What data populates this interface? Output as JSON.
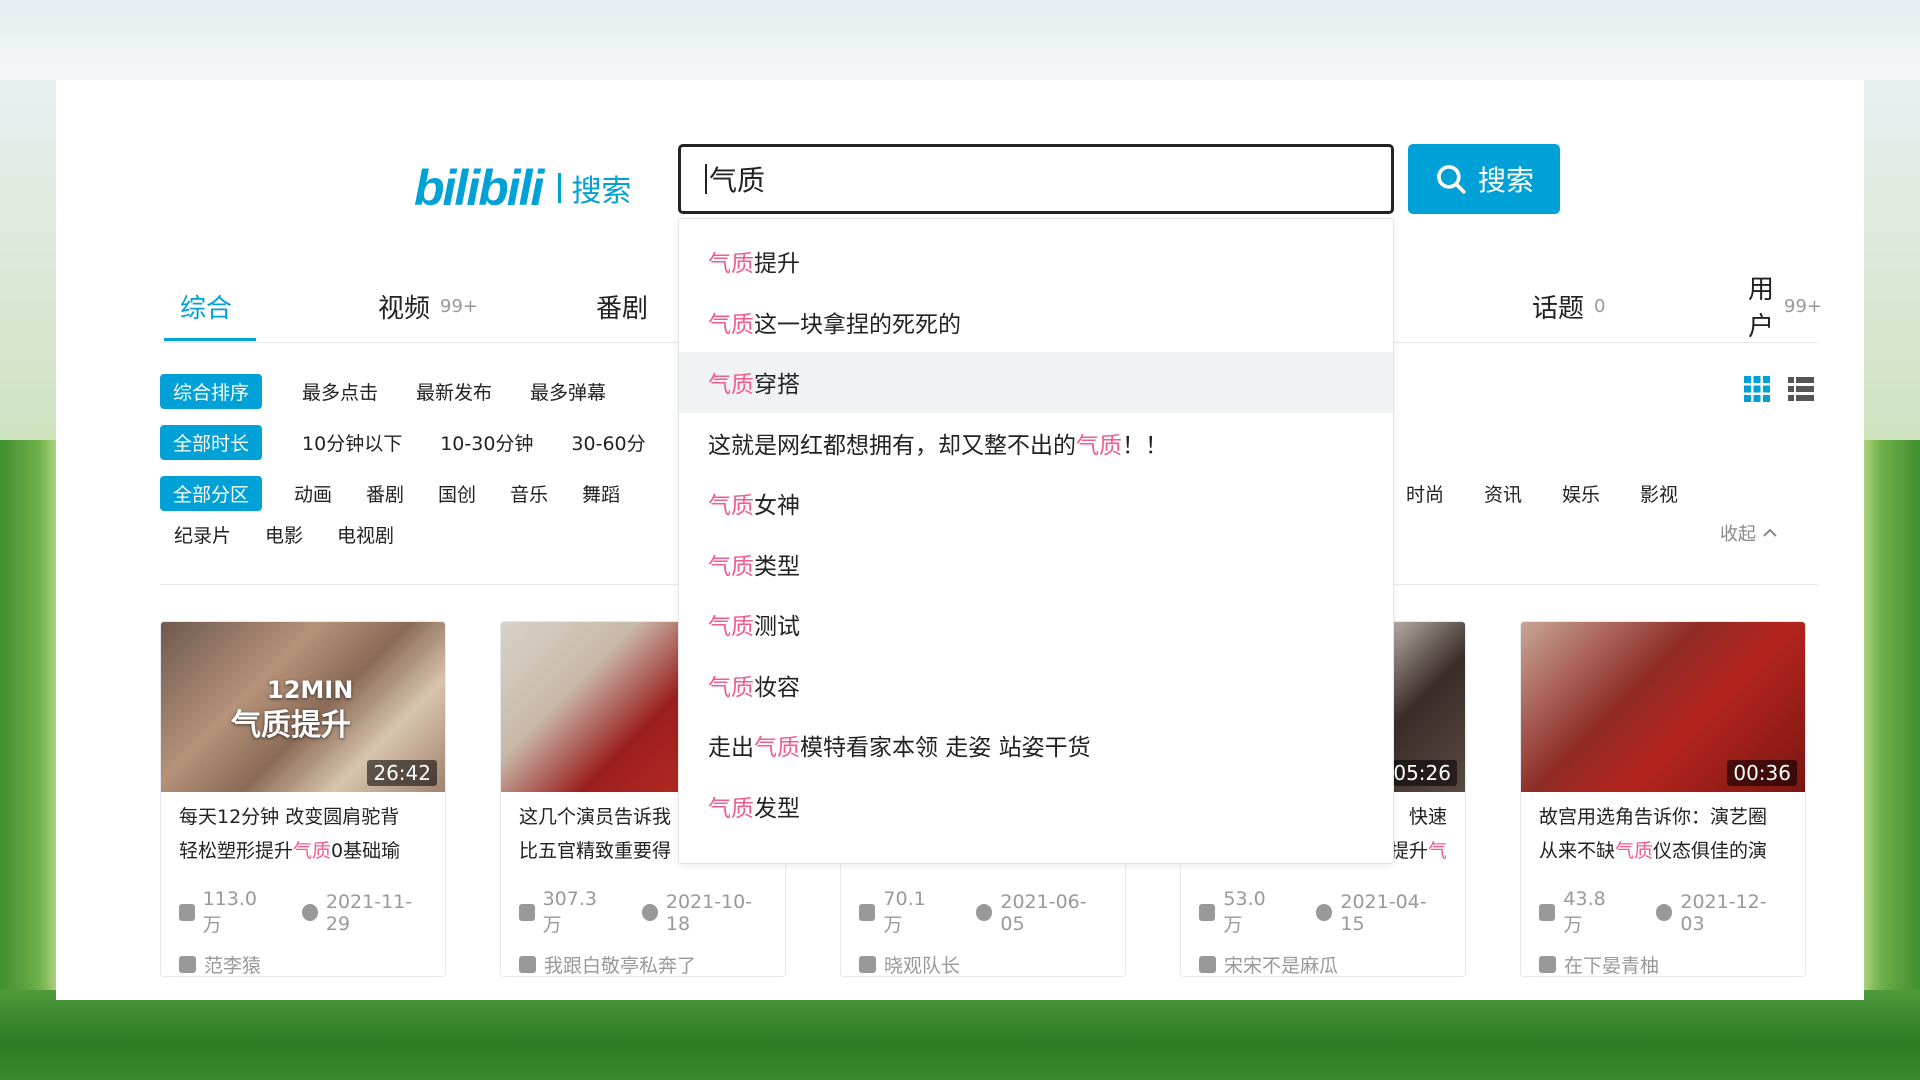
{
  "header": {
    "logo_text": "bilibili",
    "logo_sub": "搜索",
    "search_value": "气质",
    "search_button": "搜索"
  },
  "tabs": [
    {
      "label": "综合",
      "count": ""
    },
    {
      "label": "视频",
      "count": "99+"
    },
    {
      "label": "番剧",
      "count": ""
    },
    {
      "label": "话题",
      "count": "0"
    },
    {
      "label": "用户",
      "count": "99+"
    }
  ],
  "filters": {
    "sort": [
      "综合排序",
      "最多点击",
      "最新发布",
      "最多弹幕"
    ],
    "duration": [
      "全部时长",
      "10分钟以下",
      "10-30分钟",
      "30-60分"
    ],
    "zones_left": [
      "全部分区",
      "动画",
      "番剧",
      "国创",
      "音乐",
      "舞蹈"
    ],
    "zones_right": [
      "时尚",
      "资讯",
      "娱乐",
      "影视"
    ],
    "zones_row2": [
      "纪录片",
      "电影",
      "电视剧"
    ],
    "collapse": "收起"
  },
  "suggestions": [
    {
      "pre": "",
      "hl": "气质",
      "post": "提升"
    },
    {
      "pre": "",
      "hl": "气质",
      "post": "这一块拿捏的死死的"
    },
    {
      "pre": "",
      "hl": "气质",
      "post": "穿搭"
    },
    {
      "pre": "这就是网红都想拥有，却又整不出的",
      "hl": "气质",
      "post": "！！"
    },
    {
      "pre": "",
      "hl": "气质",
      "post": "女神"
    },
    {
      "pre": "",
      "hl": "气质",
      "post": "类型"
    },
    {
      "pre": "",
      "hl": "气质",
      "post": "测试"
    },
    {
      "pre": "",
      "hl": "气质",
      "post": "妆容"
    },
    {
      "pre": "走出",
      "hl": "气质",
      "post": " 模特看家本领 走姿 站姿干货"
    },
    {
      "pre": "",
      "hl": "气质",
      "post": "发型"
    }
  ],
  "videos": [
    {
      "duration": "26:42",
      "overlay_min": "12MIN",
      "overlay_title": "气质提升",
      "line1": "每天12分钟 改变圆肩驼背",
      "line2_pre": "轻松塑形提升",
      "line2_hl": "气质",
      "line2_post": "0基础瑜",
      "views": "113.0万",
      "date": "2021-11-29",
      "uploader": "范李猿"
    },
    {
      "duration": "",
      "line1": "这几个演员告诉我",
      "line2_pre": "比五官精致重要得",
      "line2_hl": "",
      "line2_post": "",
      "views": "307.3万",
      "date": "2021-10-18",
      "uploader": "我跟白敬亭私奔了"
    },
    {
      "duration": "",
      "line1": "",
      "line2_pre": "",
      "line2_hl": "",
      "line2_post": "",
      "views": "70.1万",
      "date": "2021-06-05",
      "uploader": "晓观队长"
    },
    {
      "duration": "05:26",
      "line1": "快速",
      "line2_pre": "提升",
      "line2_hl": "气",
      "line2_post": "",
      "views": "53.0万",
      "date": "2021-04-15",
      "uploader": "宋宋不是麻瓜"
    },
    {
      "duration": "00:36",
      "line1": "故宫用选角告诉你：演艺圈",
      "line2_pre": "从来不缺",
      "line2_hl": "气质",
      "line2_post": "仪态俱佳的演",
      "views": "43.8万",
      "date": "2021-12-03",
      "uploader": "在下晏青柚"
    }
  ],
  "colors": {
    "accent": "#00a1d6",
    "highlight": "#f25d8e",
    "muted": "#999999"
  }
}
